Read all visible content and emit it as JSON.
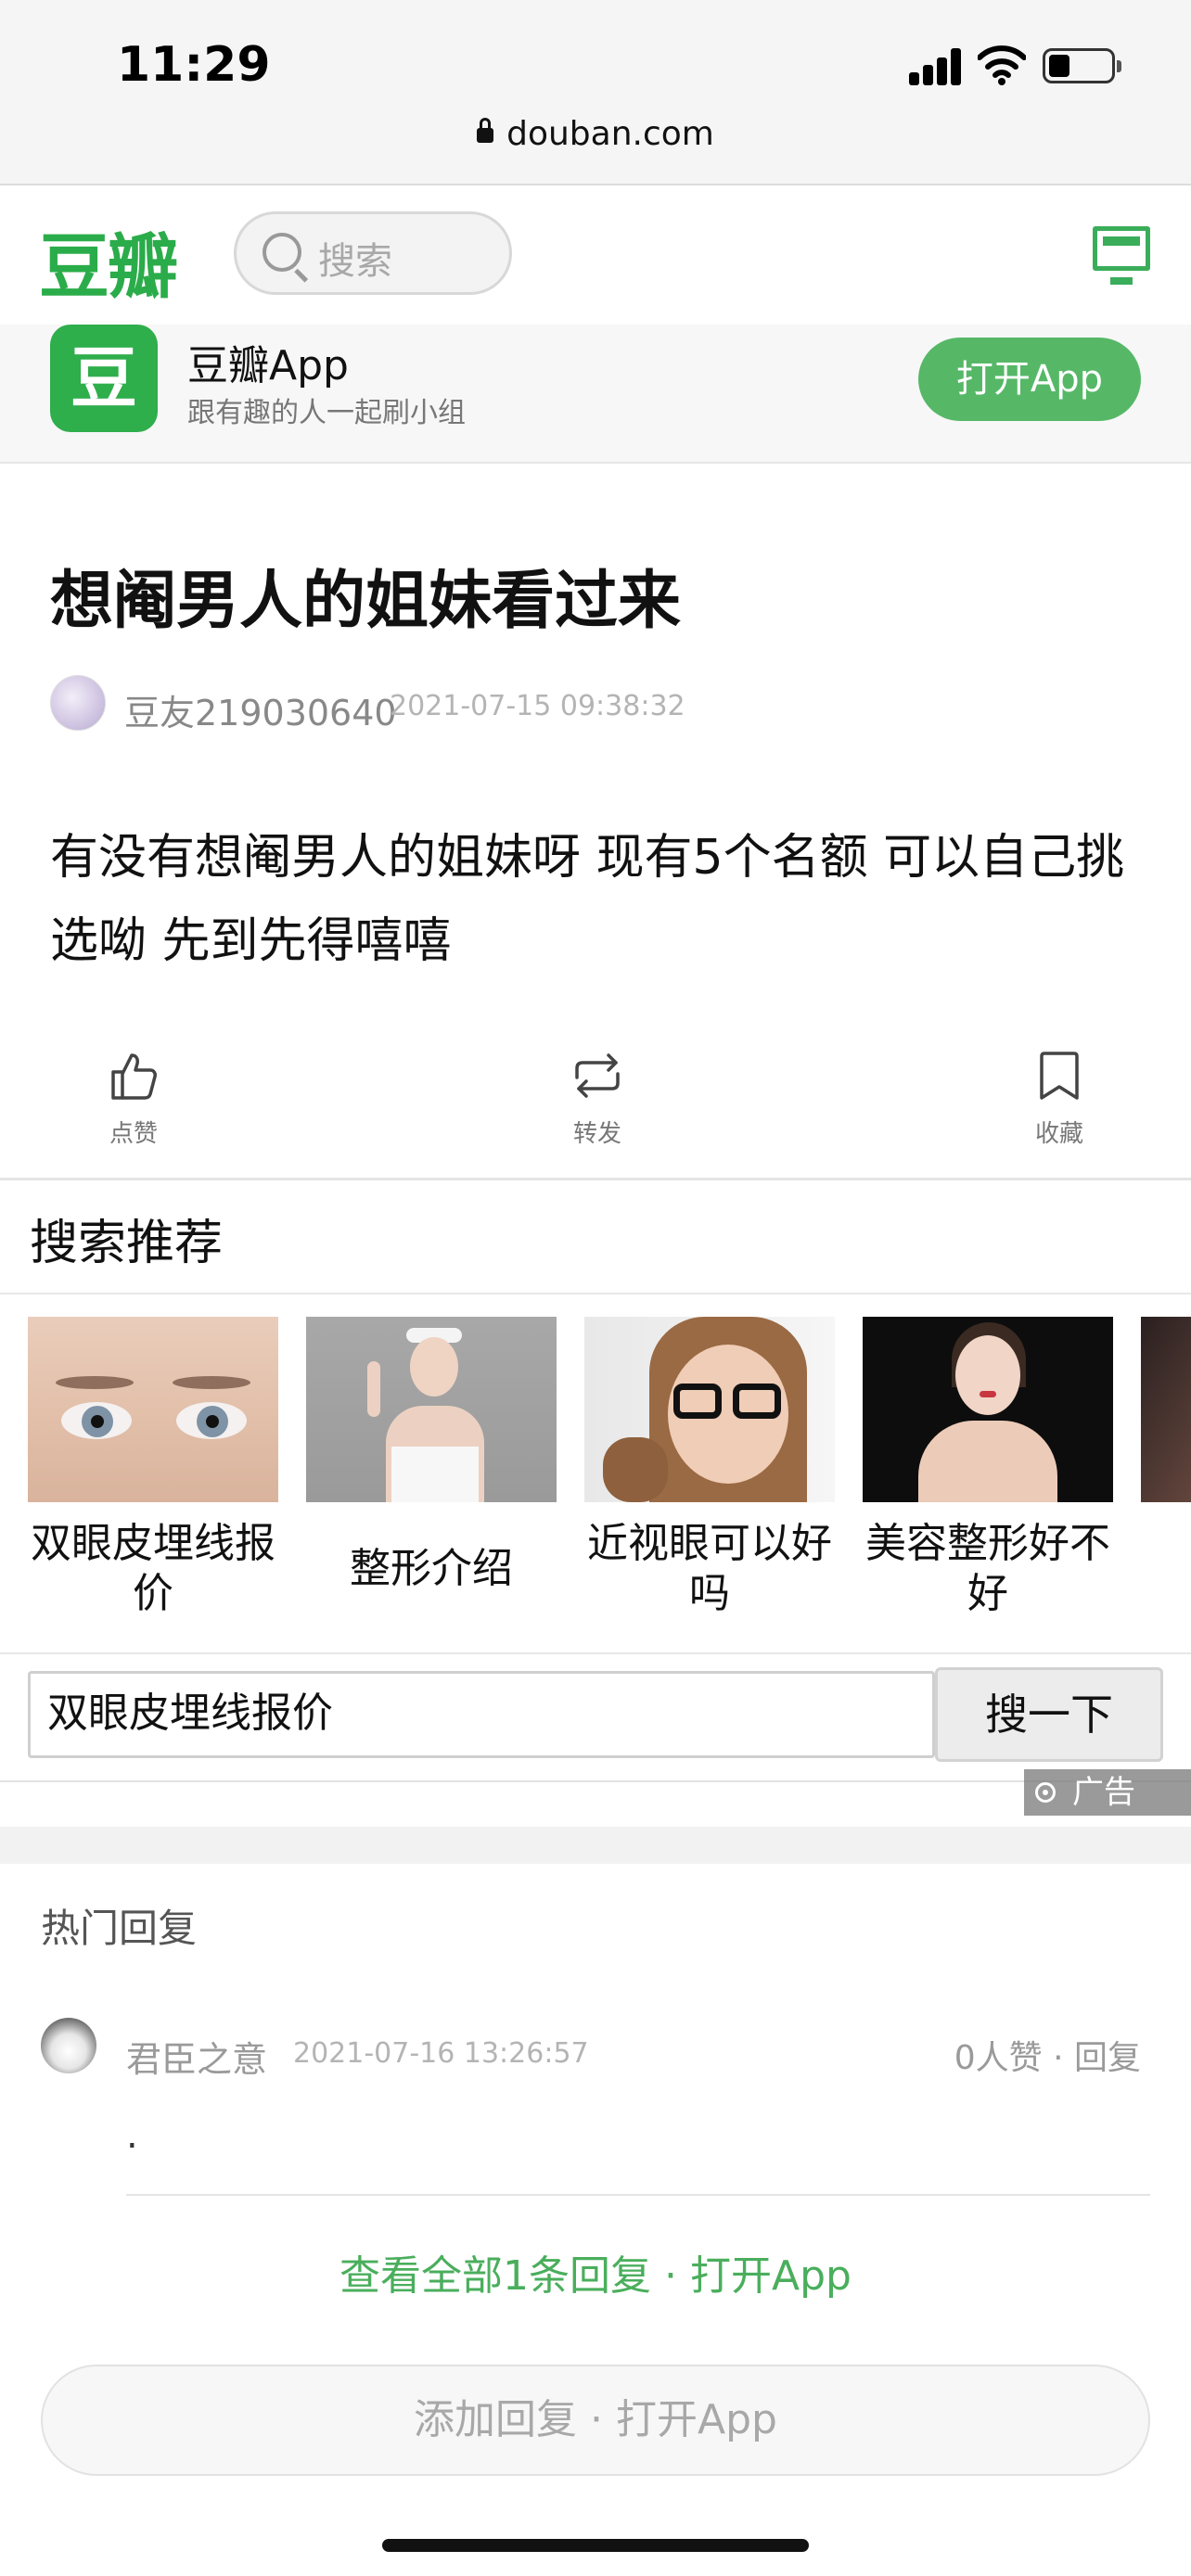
{
  "status_bar": {
    "time": "11:29",
    "url": "douban.com"
  },
  "header": {
    "logo": "豆瓣",
    "search_placeholder": "搜索"
  },
  "app_banner": {
    "icon_char": "豆",
    "name": "豆瓣App",
    "tagline": "跟有趣的人一起刷小组",
    "open_button": "打开App"
  },
  "post": {
    "title": "想阉男人的姐妹看过来",
    "author": "豆友219030640",
    "time": "2021-07-15 09:38:32",
    "body": "有没有想阉男人的姐妹呀 现有5个名额 可以自己挑选呦 先到先得嘻嘻"
  },
  "actions": {
    "like": "点赞",
    "repost": "转发",
    "collect": "收藏"
  },
  "search_recommend": {
    "title": "搜索推荐",
    "items": [
      {
        "caption": "双眼皮埋线报价"
      },
      {
        "caption": "整形介绍"
      },
      {
        "caption": "近视眼可以好吗"
      },
      {
        "caption": "美容整形好不好"
      }
    ],
    "search_value": "双眼皮埋线报价",
    "search_button": "搜一下",
    "ad_label": "广告"
  },
  "replies": {
    "title": "热门回复",
    "items": [
      {
        "name": "君臣之意",
        "time": "2021-07-16 13:26:57",
        "meta": "0人赞 · 回复",
        "body": "."
      }
    ],
    "view_all": "查看全部1条回复 · 打开App",
    "add_reply": "添加回复 · 打开App"
  }
}
